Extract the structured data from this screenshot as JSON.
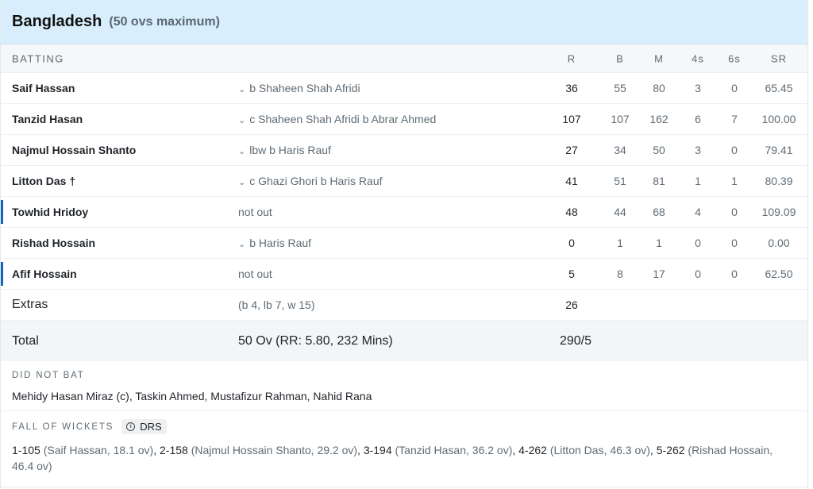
{
  "team": {
    "name": "Bangladesh",
    "format": "(50 ovs maximum)"
  },
  "columns": {
    "batting": "BATTING",
    "r": "R",
    "b": "B",
    "m": "M",
    "fours": "4s",
    "sixes": "6s",
    "sr": "SR"
  },
  "batters": [
    {
      "name": "Saif Hassan",
      "dismissal": "b Shaheen Shah Afridi",
      "r": "36",
      "b": "55",
      "m": "80",
      "fours": "3",
      "sixes": "0",
      "sr": "65.45",
      "active": false,
      "expandable": true
    },
    {
      "name": "Tanzid Hasan",
      "dismissal": "c Shaheen Shah Afridi b Abrar Ahmed",
      "r": "107",
      "b": "107",
      "m": "162",
      "fours": "6",
      "sixes": "7",
      "sr": "100.00",
      "active": false,
      "expandable": true
    },
    {
      "name": "Najmul Hossain Shanto",
      "dismissal": "lbw b Haris Rauf",
      "r": "27",
      "b": "34",
      "m": "50",
      "fours": "3",
      "sixes": "0",
      "sr": "79.41",
      "active": false,
      "expandable": true
    },
    {
      "name": "Litton Das †",
      "dismissal": "c Ghazi Ghori b Haris Rauf",
      "r": "41",
      "b": "51",
      "m": "81",
      "fours": "1",
      "sixes": "1",
      "sr": "80.39",
      "active": false,
      "expandable": true
    },
    {
      "name": "Towhid Hridoy",
      "dismissal": "not out",
      "r": "48",
      "b": "44",
      "m": "68",
      "fours": "4",
      "sixes": "0",
      "sr": "109.09",
      "active": true,
      "expandable": false
    },
    {
      "name": "Rishad Hossain",
      "dismissal": "b Haris Rauf",
      "r": "0",
      "b": "1",
      "m": "1",
      "fours": "0",
      "sixes": "0",
      "sr": "0.00",
      "active": false,
      "expandable": true
    },
    {
      "name": "Afif Hossain",
      "dismissal": "not out",
      "r": "5",
      "b": "8",
      "m": "17",
      "fours": "0",
      "sixes": "0",
      "sr": "62.50",
      "active": true,
      "expandable": false
    }
  ],
  "extras": {
    "label": "Extras",
    "detail": "(b 4, lb 7, w 15)",
    "value": "26"
  },
  "total": {
    "label": "Total",
    "detail": "50 Ov (RR: 5.80, 232 Mins)",
    "value": "290/5"
  },
  "did_not_bat": {
    "label": "DID NOT BAT",
    "players": "Mehidy Hasan Miraz (c), Taskin Ahmed, Mustafizur Rahman, Nahid Rana"
  },
  "fall_of_wickets": {
    "label": "FALL OF WICKETS",
    "drs_label": "DRS",
    "items": [
      {
        "score": "1-105",
        "detail": "(Saif Hassan, 18.1 ov)"
      },
      {
        "score": "2-158",
        "detail": "(Najmul Hossain Shanto, 29.2 ov)"
      },
      {
        "score": "3-194",
        "detail": "(Tanzid Hasan, 36.2 ov)"
      },
      {
        "score": "4-262",
        "detail": "(Litton Das, 46.3 ov)"
      },
      {
        "score": "5-262",
        "detail": "(Rishad Hossain, 46.4 ov)"
      }
    ]
  },
  "colors": {
    "header_bg": "#d9eefc",
    "active_bar": "#1565c0"
  },
  "icons": {
    "expand": "chevron-down-icon",
    "info": "info-icon"
  }
}
